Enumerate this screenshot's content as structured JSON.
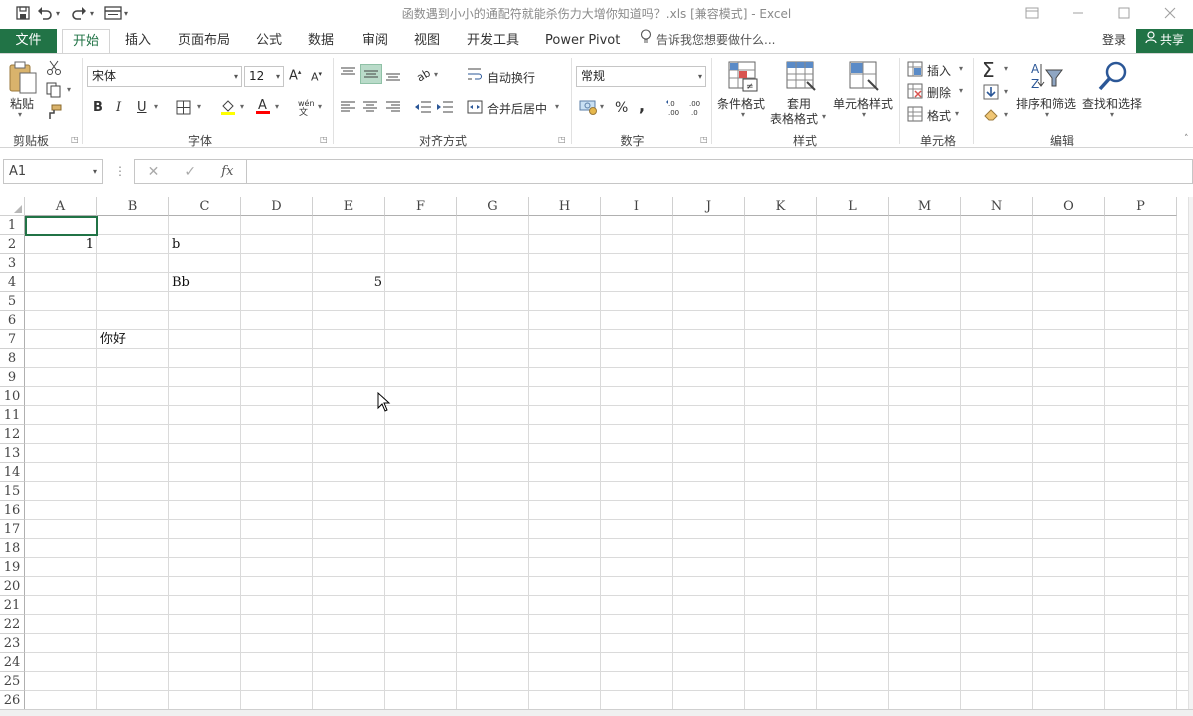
{
  "window": {
    "title": "函数遇到小小的通配符就能杀伤力大增你知道吗？.xls  [兼容模式] - Excel",
    "controls": [
      "restore-ribbon",
      "minimize",
      "maximize",
      "close"
    ]
  },
  "tabs": {
    "file": "文件",
    "items": [
      "开始",
      "插入",
      "页面布局",
      "公式",
      "数据",
      "审阅",
      "视图",
      "开发工具",
      "Power Pivot"
    ],
    "tell_me": "告诉我您想要做什么...",
    "login": "登录",
    "share": "共享"
  },
  "ribbon": {
    "clipboard": {
      "paste": "粘贴",
      "label": "剪贴板"
    },
    "font": {
      "name": "宋体",
      "size": "12",
      "bold": "B",
      "italic": "I",
      "underline": "U",
      "label": "字体"
    },
    "alignment": {
      "wrap": "自动换行",
      "merge": "合并后居中",
      "label": "对齐方式"
    },
    "number": {
      "format": "常规",
      "percent": "%",
      "comma": ",",
      "label": "数字"
    },
    "styles": {
      "conditional": "条件格式",
      "table_line1": "套用",
      "table_line2": "表格格式",
      "cell_styles": "单元格样式",
      "label": "样式"
    },
    "cells": {
      "insert": "插入",
      "delete": "删除",
      "format": "格式",
      "label": "单元格"
    },
    "editing": {
      "sort": "排序和筛选",
      "find": "查找和选择",
      "label": "编辑"
    }
  },
  "formula_bar": {
    "name_box": "A1",
    "fx": "fx",
    "formula": ""
  },
  "sheet": {
    "columns": [
      "A",
      "B",
      "C",
      "D",
      "E",
      "F",
      "G",
      "H",
      "I",
      "J",
      "K",
      "L",
      "M",
      "N",
      "O",
      "P"
    ],
    "rows": [
      "1",
      "2",
      "3",
      "4",
      "5",
      "6",
      "7",
      "8",
      "9",
      "10",
      "11",
      "12",
      "13",
      "14",
      "15",
      "16",
      "17",
      "18",
      "19",
      "20",
      "21",
      "22",
      "23",
      "24",
      "25",
      "26"
    ],
    "cells": [
      {
        "ref": "A2",
        "value": "1"
      },
      {
        "ref": "C2",
        "value": "b"
      },
      {
        "ref": "C4",
        "value": "Bb"
      },
      {
        "ref": "E4",
        "value": "5"
      },
      {
        "ref": "B7",
        "value": "你好"
      }
    ],
    "selected": "A1"
  },
  "colors": {
    "accent": "#217346",
    "grid": "#dadada"
  }
}
